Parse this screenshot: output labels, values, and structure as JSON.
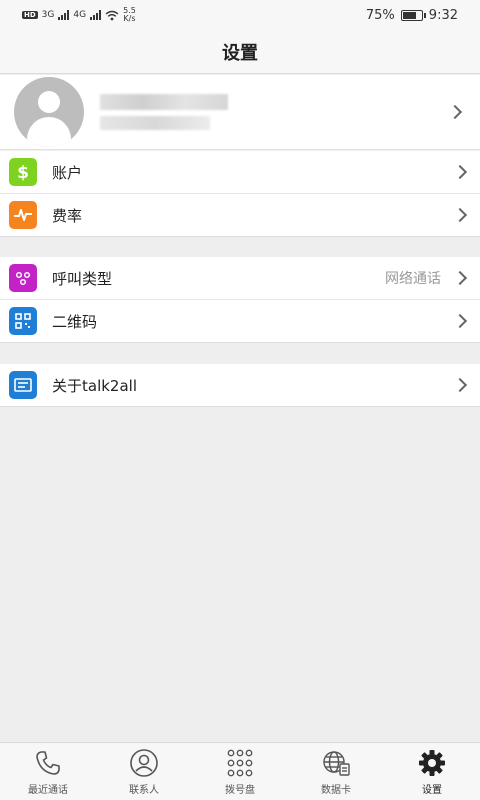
{
  "status_bar": {
    "hd": "HD",
    "net1": "3G",
    "net2": "4G",
    "speed_value": "5.5",
    "speed_unit": "K/s",
    "battery_percent": 75,
    "battery_text": "75%",
    "time": "9:32"
  },
  "title": "设置",
  "settings_groups": [
    [
      {
        "label": "账户",
        "icon": "dollar-icon",
        "color": "#7ed321"
      },
      {
        "label": "费率",
        "icon": "pulse-icon",
        "color": "#f5841f"
      }
    ],
    [
      {
        "label": "呼叫类型",
        "icon": "dots-icon",
        "color": "#c322c7",
        "value": "网络通话"
      },
      {
        "label": "二维码",
        "icon": "qr-code-icon",
        "color": "#1f7fd6"
      }
    ],
    [
      {
        "label": "关于talk2all",
        "icon": "info-card-icon",
        "color": "#1f7fd6"
      }
    ]
  ],
  "tabs": [
    {
      "label": "最近通话",
      "icon": "phone-icon"
    },
    {
      "label": "联系人",
      "icon": "contact-icon"
    },
    {
      "label": "拨号盘",
      "icon": "dialpad-icon"
    },
    {
      "label": "数据卡",
      "icon": "globe-card-icon"
    },
    {
      "label": "设置",
      "icon": "gear-icon",
      "active": true
    }
  ]
}
